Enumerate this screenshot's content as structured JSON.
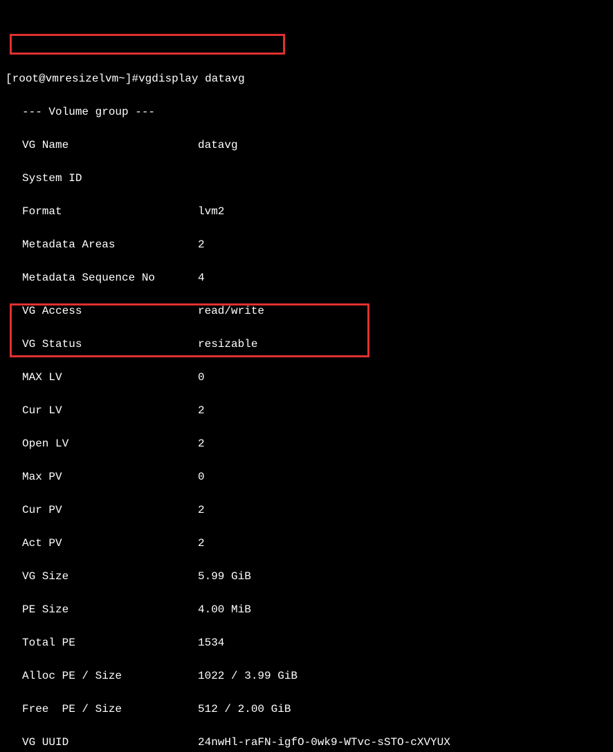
{
  "prompt": {
    "user_host": "root@vmresizelvm",
    "path": "~",
    "symbol": "#",
    "command": "vgdisplay datavg"
  },
  "header": "--- Volume group ---",
  "fields": {
    "vg_name": {
      "label": "VG Name",
      "value": "datavg"
    },
    "system_id": {
      "label": "System ID",
      "value": ""
    },
    "format": {
      "label": "Format",
      "value": "lvm2"
    },
    "metadata_areas": {
      "label": "Metadata Areas",
      "value": "2"
    },
    "metadata_seq": {
      "label": "Metadata Sequence No",
      "value": "4"
    },
    "vg_access": {
      "label": "VG Access",
      "value": "read/write"
    },
    "vg_status": {
      "label": "VG Status",
      "value": "resizable"
    },
    "max_lv": {
      "label": "MAX LV",
      "value": "0"
    },
    "cur_lv": {
      "label": "Cur LV",
      "value": "2"
    },
    "open_lv": {
      "label": "Open LV",
      "value": "2"
    },
    "max_pv": {
      "label": "Max PV",
      "value": "0"
    },
    "cur_pv": {
      "label": "Cur PV",
      "value": "2"
    },
    "act_pv": {
      "label": "Act PV",
      "value": "2"
    },
    "vg_size": {
      "label": "VG Size",
      "value": "5.99 GiB"
    },
    "pe_size": {
      "label": "PE Size",
      "value": "4.00 MiB"
    },
    "total_pe": {
      "label": "Total PE",
      "value": "1534"
    },
    "alloc_pe": {
      "label": "Alloc PE / Size",
      "value": "1022 / 3.99 GiB"
    },
    "free_pe": {
      "label": "Free  PE / Size",
      "value": "512 / 2.00 GiB"
    },
    "vg_uuid": {
      "label": "VG UUID",
      "value": "24nwHl-raFN-igfO-0wk9-WTvc-sSTO-cXVYUX"
    }
  }
}
